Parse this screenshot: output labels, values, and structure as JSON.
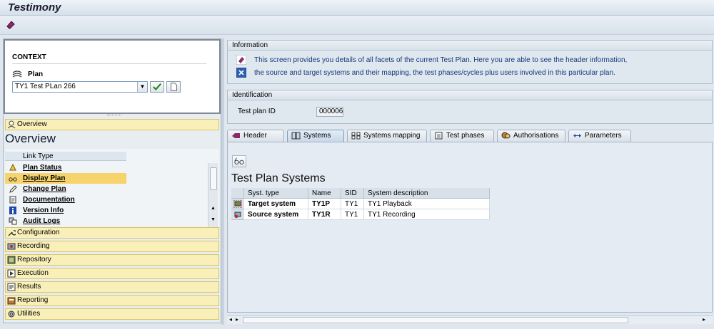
{
  "window": {
    "title": "Testimony"
  },
  "context": {
    "heading": "CONTEXT",
    "plan_label": "Plan",
    "plan_value": "TY1 Test PLan 266"
  },
  "nav": {
    "overview_bar": "Overview",
    "overview_heading": "Overview",
    "link_type_header": "Link Type",
    "links": [
      {
        "label": "Plan Status",
        "icon": "status-bell-icon"
      },
      {
        "label": "Display Plan",
        "icon": "display-glasses-icon",
        "selected": true
      },
      {
        "label": "Change Plan",
        "icon": "pencil-icon"
      },
      {
        "label": "Documentation",
        "icon": "document-icon"
      },
      {
        "label": "Version Info",
        "icon": "info-icon"
      },
      {
        "label": "Audit Logs",
        "icon": "log-icon"
      }
    ],
    "sections": [
      "Configuration",
      "Recording",
      "Repository",
      "Execution",
      "Results",
      "Reporting",
      "Utilities"
    ]
  },
  "information": {
    "heading": "Information",
    "line1": "This screen provides you details of all facets of the current Test Plan. Here you are able to see the header information,",
    "line2": "the source and target systems and their mapping, the test phases/cycles plus users involved in this particular plan."
  },
  "identification": {
    "heading": "Identification",
    "label": "Test plan ID",
    "value": "000006"
  },
  "tabs": [
    "Header",
    "Systems",
    "Systems mapping",
    "Test phases",
    "Authorisations",
    "Parameters"
  ],
  "active_tab": "Systems",
  "systems": {
    "title": "Test Plan Systems",
    "columns": [
      "Syst. type",
      "Name",
      "SID",
      "System description"
    ],
    "rows": [
      {
        "type": "Target system",
        "name": "TY1P",
        "sid": "TY1",
        "description": "TY1 Playback"
      },
      {
        "type": "Source system",
        "name": "TY1R",
        "sid": "TY1",
        "description": "TY1 Recording"
      }
    ]
  },
  "colors": {
    "accent": "#f6d36b",
    "info_text": "#163a7a",
    "nav_bar": "#f8f0b8"
  }
}
